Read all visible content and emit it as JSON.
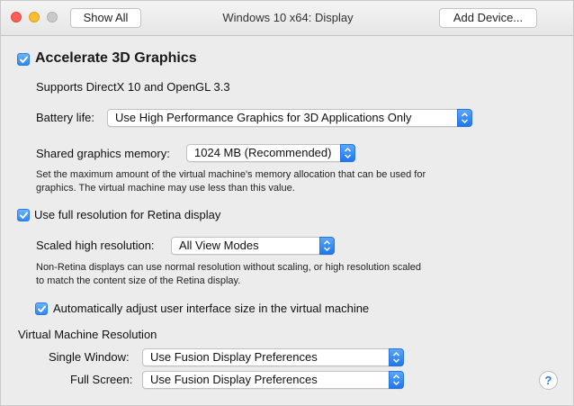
{
  "window": {
    "title": "Windows 10 x64: Display",
    "show_all_label": "Show All",
    "add_device_label": "Add Device..."
  },
  "accelerate": {
    "checked": true,
    "label": "Accelerate 3D Graphics",
    "supports_text": "Supports DirectX 10 and OpenGL 3.3"
  },
  "battery": {
    "label": "Battery life:",
    "value": "Use High Performance Graphics for 3D Applications Only"
  },
  "memory": {
    "label": "Shared graphics memory:",
    "value": "1024 MB (Recommended)",
    "description_line1": "Set the maximum amount of the virtual machine's memory allocation that can be used for",
    "description_line2": "graphics. The virtual machine may use less than this value."
  },
  "retina": {
    "checked": true,
    "label": "Use full resolution for Retina display",
    "scaled_label": "Scaled high resolution:",
    "scaled_value": "All View Modes",
    "description_line1": "Non-Retina displays can use normal resolution without scaling, or high resolution scaled",
    "description_line2": "to match the content size of the Retina display."
  },
  "auto_adjust": {
    "checked": true,
    "label": "Automatically adjust user interface size in the virtual machine"
  },
  "resolution": {
    "heading": "Virtual Machine Resolution",
    "single_label": "Single Window:",
    "single_value": "Use Fusion Display Preferences",
    "full_label": "Full Screen:",
    "full_value": "Use Fusion Display Preferences"
  },
  "help": {
    "symbol": "?"
  },
  "colors": {
    "accent": "#2d88f3",
    "window_bg": "#ececec"
  }
}
